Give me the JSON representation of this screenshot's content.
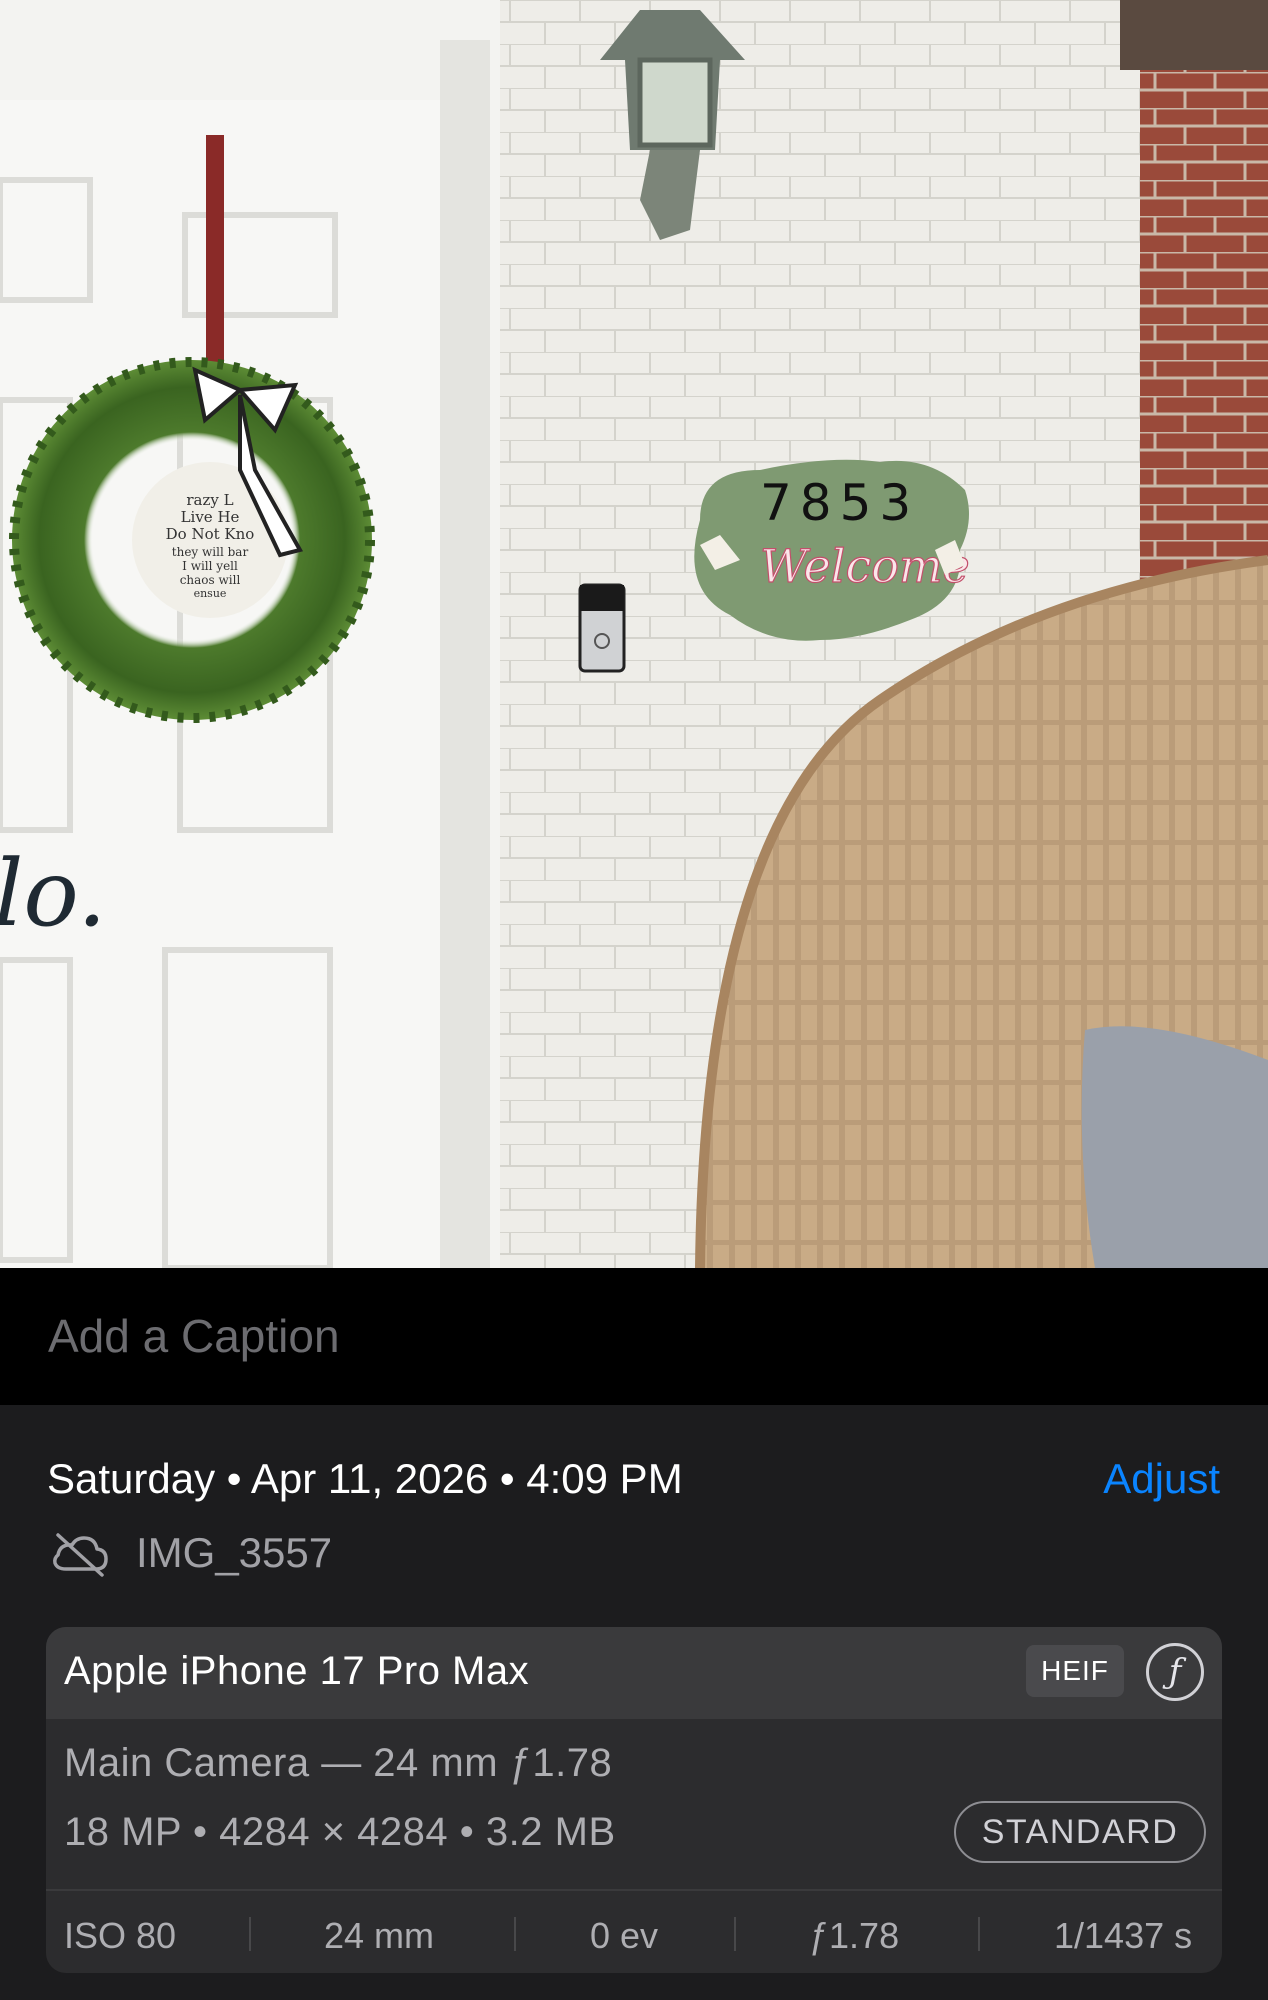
{
  "caption": {
    "placeholder": "Add a Caption"
  },
  "photo": {
    "sign_number": "7853",
    "sign_text": "Welcome",
    "door_text_fragment": "lo.",
    "wreath_sign_lines": [
      "razy L",
      "Live He",
      "Do Not Kno",
      "they will bar",
      "I will yell",
      "chaos will",
      "ensue"
    ]
  },
  "info": {
    "date": "Saturday • Apr 11, 2026 • 4:09 PM",
    "adjust_label": "Adjust",
    "filename": "IMG_3557",
    "cloud_icon": "cloud-slash-icon"
  },
  "camera": {
    "device": "Apple iPhone 17 Pro Max",
    "format": "HEIF",
    "lens": "Main Camera — 24 mm ƒ1.78",
    "resolution": "18 MP • 4284 × 4284 • 3.2 MB",
    "style": "STANDARD",
    "exif": {
      "iso": "ISO 80",
      "focal": "24 mm",
      "ev": "0 ev",
      "aperture": "ƒ1.78",
      "shutter": "1/1437 s"
    }
  },
  "colors": {
    "accent": "#0a84ff",
    "panel": "#1c1c1e",
    "card": "#2c2c2e"
  }
}
